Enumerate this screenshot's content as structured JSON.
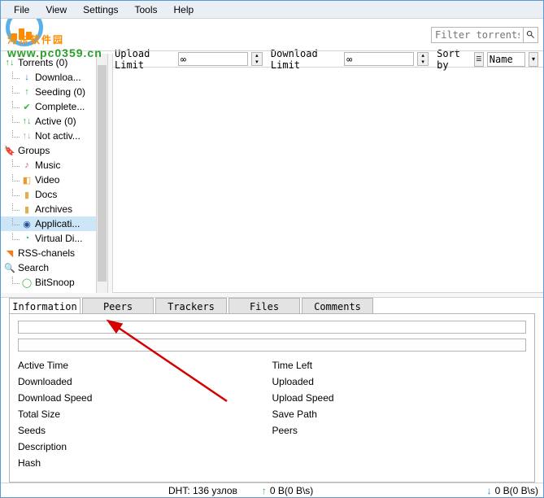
{
  "menu": [
    "File",
    "View",
    "Settings",
    "Tools",
    "Help"
  ],
  "watermark": {
    "text": "河东软件园",
    "url": "www.pc0359.cn"
  },
  "filter": {
    "placeholder": "Filter torrents"
  },
  "limits": {
    "upload_label": "Upload Limit",
    "upload_value": "∞",
    "download_label": "Download Limit",
    "download_value": "∞",
    "sort_label": "Sort by",
    "sort_value": "Name"
  },
  "tree": [
    {
      "label": "Torrents (0)",
      "icon": "↑↓",
      "cls": "green",
      "depth": 0
    },
    {
      "label": "Downloa...",
      "icon": "↓",
      "cls": "blue",
      "depth": 1
    },
    {
      "label": "Seeding (0)",
      "icon": "↑",
      "cls": "green",
      "depth": 1
    },
    {
      "label": "Complete...",
      "icon": "✔",
      "cls": "green",
      "depth": 1
    },
    {
      "label": "Active (0)",
      "icon": "↑↓",
      "cls": "green",
      "depth": 1
    },
    {
      "label": "Not activ...",
      "icon": "↑↓",
      "cls": "gray",
      "depth": 1
    },
    {
      "label": "Groups",
      "icon": "🔖",
      "cls": "blue",
      "depth": 0
    },
    {
      "label": "Music",
      "icon": "♪",
      "cls": "pink",
      "depth": 1
    },
    {
      "label": "Video",
      "icon": "◧",
      "cls": "orange",
      "depth": 1
    },
    {
      "label": "Docs",
      "icon": "▮",
      "cls": "folder",
      "depth": 1
    },
    {
      "label": "Archives",
      "icon": "▮",
      "cls": "folder",
      "depth": 1
    },
    {
      "label": "Applicati...",
      "icon": "◉",
      "cls": "darkblue",
      "depth": 1,
      "selected": true
    },
    {
      "label": "Virtual Di...",
      "icon": "◔",
      "cls": "teal",
      "depth": 1
    },
    {
      "label": "RSS-chanels",
      "icon": "◥",
      "cls": "rss",
      "depth": 0
    },
    {
      "label": "Search",
      "icon": "🔍",
      "cls": "",
      "depth": 0
    },
    {
      "label": "BitSnoop",
      "icon": "◯",
      "cls": "green",
      "depth": 1
    }
  ],
  "tabs": [
    "Information",
    "Peers",
    "Trackers",
    "Files",
    "Comments"
  ],
  "active_tab": 0,
  "info_labels_left": [
    "Active Time",
    "Downloaded",
    "Download Speed",
    "Total Size",
    "Seeds",
    "Description",
    "Hash"
  ],
  "info_labels_right": [
    "Time Left",
    "Uploaded",
    "Upload Speed",
    "Save Path",
    "Peers"
  ],
  "status": {
    "dht": "DHT: 136 узлов",
    "up": "0 B(0 B\\s)",
    "down": "0 B(0 B\\s)"
  }
}
